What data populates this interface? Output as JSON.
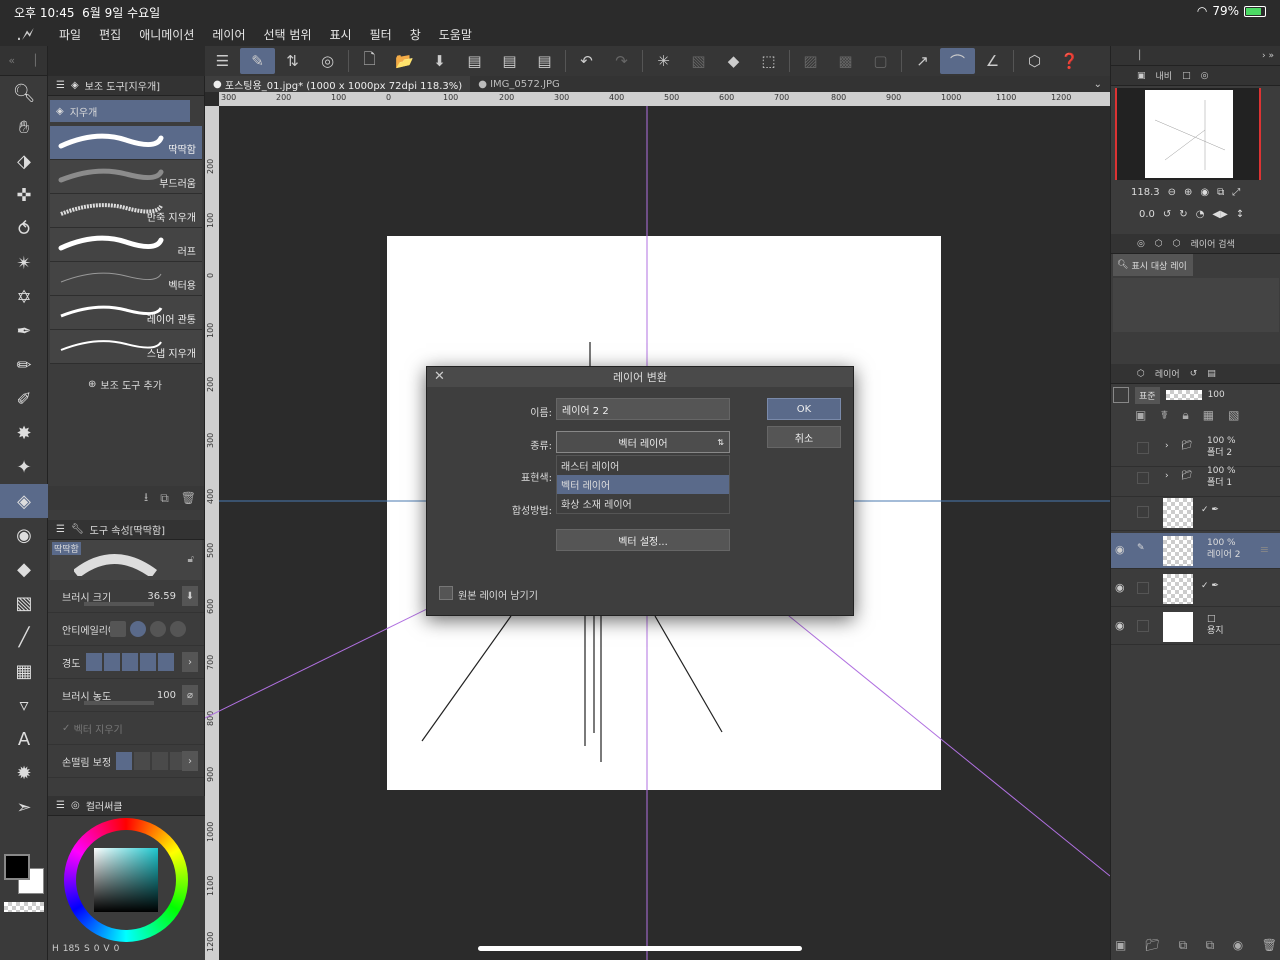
{
  "status": {
    "time": "오후 10:45",
    "date": "6월 9일 수요일",
    "battery": "79%"
  },
  "menu": [
    "파일",
    "편집",
    "애니메이션",
    "레이어",
    "선택 범위",
    "표시",
    "필터",
    "창",
    "도움말"
  ],
  "tabs": [
    {
      "label": "포스팅용_01.jpg* (1000 x 1000px 72dpi 118.3%)",
      "active": true
    },
    {
      "label": "IMG_0572.JPG",
      "active": false
    }
  ],
  "subtool": {
    "title": "보조 도구[지우개]",
    "group": "지우개",
    "brushes": [
      "딱딱함",
      "부드러움",
      "반죽 지우개",
      "러프",
      "벡터용",
      "레이어 관통",
      "스냅 지우개"
    ],
    "add_label": "보조 도구 추가"
  },
  "toolprop": {
    "title": "도구 속성[딱딱함]",
    "preview_label": "딱딱함",
    "brush_size_label": "브러시 크기",
    "brush_size": "36.59",
    "antialias_label": "안티에일리어",
    "hardness_label": "경도",
    "density_label": "브러시 농도",
    "density": "100",
    "vector_erase_label": "벡터 지우기",
    "stabilize_label": "손떨림 보정"
  },
  "colorwheel": {
    "title": "컬러써클",
    "h_label": "H",
    "h": "185",
    "s_label": "S",
    "s": "0",
    "v_label": "V",
    "v": "0"
  },
  "navigator": {
    "title": "내비",
    "zoom": "118.3",
    "angle": "0.0"
  },
  "search": {
    "title": "레이어 검색",
    "filter": "표시 대상 레이"
  },
  "layers_panel": {
    "title": "레이어",
    "blend": "표준",
    "opacity": "100",
    "layers": [
      {
        "pct": "100 %",
        "name": "폴더 2",
        "type": "folder"
      },
      {
        "pct": "100 %",
        "name": "폴더 1",
        "type": "folder"
      },
      {
        "pct": "",
        "name": "",
        "type": "vector"
      },
      {
        "pct": "100 %",
        "name": "레이어 2",
        "type": "raster",
        "active": true
      },
      {
        "pct": "",
        "name": "",
        "type": "vector"
      },
      {
        "pct": "",
        "name": "용지",
        "type": "paper"
      }
    ]
  },
  "dialog": {
    "title": "레이어 변환",
    "name_label": "이름:",
    "name_value": "레이어 2 2",
    "type_label": "종류:",
    "type_value": "벡터 레이어",
    "color_label": "표현색:",
    "blend_label": "합성방법:",
    "type_options": [
      "래스터 레이어",
      "벡터 레이어",
      "화상 소재 레이어"
    ],
    "vector_settings": "벡터 설정...",
    "keep_original": "원본 레이어 남기기",
    "ok": "OK",
    "cancel": "취소"
  },
  "rulers": {
    "h": [
      "300",
      "200",
      "100",
      "0",
      "100",
      "200",
      "300",
      "400",
      "500",
      "600",
      "700",
      "800",
      "900",
      "1000",
      "1100",
      "1200"
    ],
    "v": [
      "200",
      "100",
      "0",
      "100",
      "200",
      "300",
      "400",
      "500",
      "600",
      "700",
      "800",
      "900",
      "1000",
      "1100",
      "1200"
    ]
  },
  "colors": {
    "accent": "#5a6a8a",
    "panel": "#3c3c3c",
    "bg": "#2b2b2b"
  }
}
